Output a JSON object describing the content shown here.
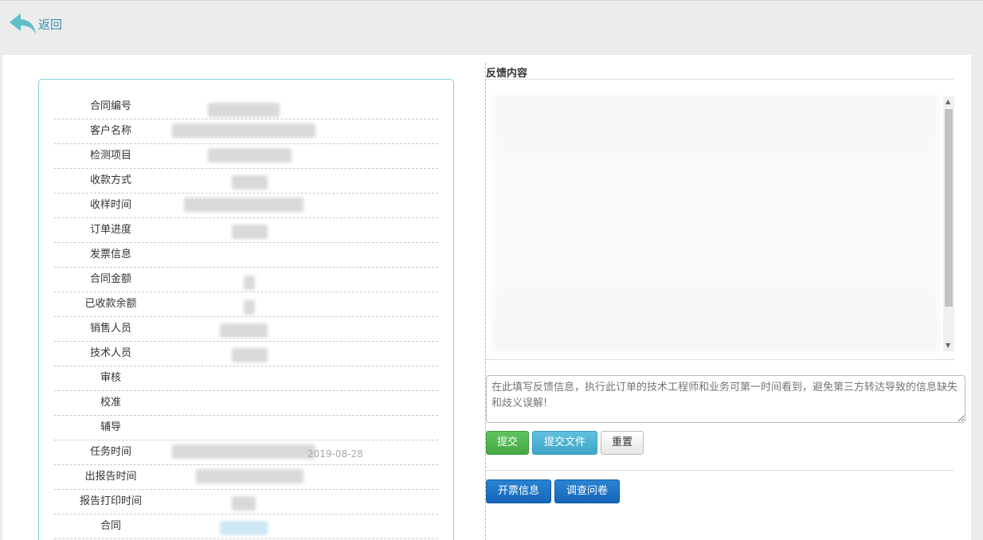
{
  "header": {
    "back_label": "返回"
  },
  "info_rows": [
    {
      "label": "合同编号"
    },
    {
      "label": "客户名称"
    },
    {
      "label": "检测项目"
    },
    {
      "label": "收款方式"
    },
    {
      "label": "收样时间"
    },
    {
      "label": "订单进度"
    },
    {
      "label": "发票信息"
    },
    {
      "label": "合同金额"
    },
    {
      "label": "已收款余额"
    },
    {
      "label": "销售人员"
    },
    {
      "label": "技术人员"
    },
    {
      "label": "审核"
    },
    {
      "label": "校准"
    },
    {
      "label": "辅导"
    },
    {
      "label": "任务时间",
      "value_visible_fragment": "2019-08-28"
    },
    {
      "label": "出报告时间"
    },
    {
      "label": "报告打印时间"
    },
    {
      "label": "合同"
    }
  ],
  "feedback": {
    "title": "反馈内容",
    "placeholder": "在此填写反馈信息，执行此订单的技术工程师和业务可第一时间看到，避免第三方转达导致的信息缺失和歧义误解!",
    "submit_label": "提交",
    "submit_file_label": "提交文件",
    "reset_label": "重置",
    "invoice_label": "开票信息",
    "survey_label": "调查问卷"
  },
  "colors": {
    "accent_border": "#7fcfe0",
    "green": "#45a845",
    "teal": "#3ea6c8",
    "blue": "#1565b8",
    "back_icon": "#5fbfc8"
  }
}
